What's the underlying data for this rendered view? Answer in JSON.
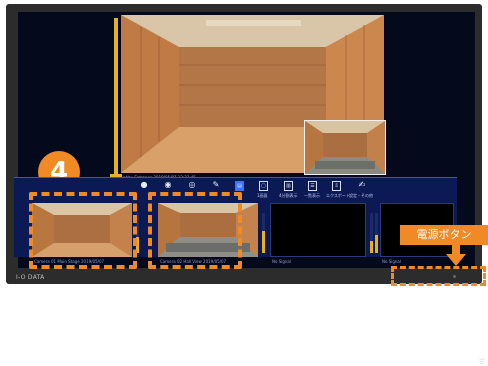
{
  "step_badge": "4",
  "power_button_label": "電源ボタン",
  "brand": "I-O DATA",
  "main_caption": "Lobby Entrance 2019/05/07 12:23:45",
  "thumbnails": [
    {
      "caption": "Camera 01 Main Stage 2019/05/07"
    },
    {
      "caption": "Camera 02 Hall View 2019/05/07"
    },
    {
      "caption": "No Signal"
    },
    {
      "caption": "No Signal"
    }
  ],
  "toolbar": [
    {
      "icon": "record-icon",
      "glyph": "●",
      "label": ""
    },
    {
      "icon": "camera-icon",
      "glyph": "◉",
      "label": ""
    },
    {
      "icon": "playback-icon",
      "glyph": "◎",
      "label": ""
    },
    {
      "icon": "tools-icon",
      "glyph": "✎",
      "label": ""
    },
    {
      "icon": "layout-icon",
      "glyph": "▤",
      "label": ""
    },
    {
      "icon": "single-view-icon",
      "glyph": "▢",
      "label": "1画面"
    },
    {
      "icon": "grid-view-icon",
      "glyph": "▥",
      "label": "4分割表示"
    },
    {
      "icon": "list-view-icon",
      "glyph": "☰",
      "label": "一覧表示"
    },
    {
      "icon": "export-icon",
      "glyph": "⇩",
      "label": "エクスポート"
    },
    {
      "icon": "settings-icon",
      "glyph": "✍",
      "label": "設定・その他"
    }
  ],
  "meters": [
    0.4,
    0.55,
    0.3,
    0.45
  ],
  "colors": {
    "accent": "#f08a24",
    "panel": "#0b1a55",
    "meter": "#e6b11f"
  }
}
